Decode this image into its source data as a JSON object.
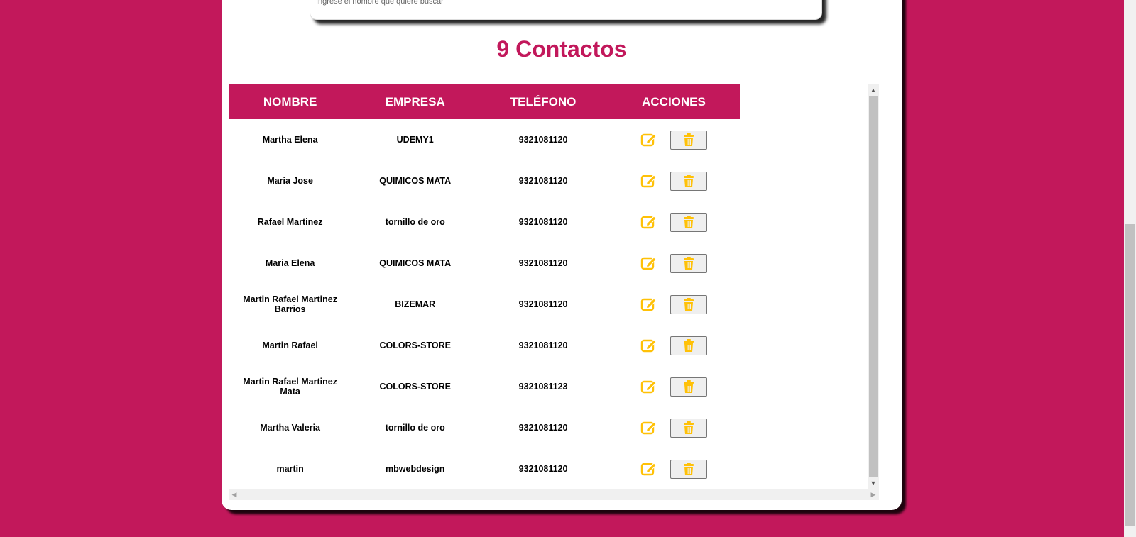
{
  "search": {
    "hint": "Ingrese el nombre que quiere buscar"
  },
  "title": "9 Contactos",
  "table": {
    "headers": [
      "NOMBRE",
      "EMPRESA",
      "TELÉFONO",
      "ACCIONES"
    ],
    "rows": [
      {
        "name": "Martha Elena",
        "company": "UDEMY1",
        "phone": "9321081120"
      },
      {
        "name": "Maria Jose",
        "company": "QUIMICOS MATA",
        "phone": "9321081120"
      },
      {
        "name": "Rafael Martinez",
        "company": "tornillo de oro",
        "phone": "9321081120"
      },
      {
        "name": "Maria Elena",
        "company": "QUIMICOS MATA",
        "phone": "9321081120"
      },
      {
        "name": "Martin Rafael Martinez Barrios",
        "company": "BIZEMAR",
        "phone": "9321081120"
      },
      {
        "name": "Martin Rafael",
        "company": "COLORS-STORE",
        "phone": "9321081120"
      },
      {
        "name": "Martin Rafael Martinez Mata",
        "company": "COLORS-STORE",
        "phone": "9321081123"
      },
      {
        "name": "Martha Valeria",
        "company": "tornillo de oro",
        "phone": "9321081120"
      },
      {
        "name": "martin",
        "company": "mbwebdesign",
        "phone": "9321081120"
      }
    ]
  },
  "icons": {
    "edit": "edit-icon",
    "delete": "trash-icon"
  },
  "colors": {
    "brand": "#c2185b",
    "icon": "#ffc107"
  }
}
